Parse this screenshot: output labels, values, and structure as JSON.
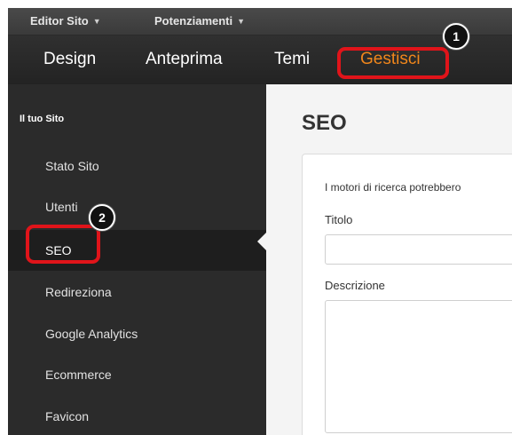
{
  "topbar": {
    "site_editor": "Editor Sito",
    "upgrades": "Potenziamenti",
    "caret": "▼"
  },
  "nav": {
    "design": "Design",
    "preview": "Anteprima",
    "themes": "Temi",
    "manage": "Gestisci"
  },
  "badges": {
    "step1": "1",
    "step2": "2"
  },
  "sidebar": {
    "title": "Il tuo Sito",
    "items": [
      {
        "label": "Stato Sito"
      },
      {
        "label": "Utenti"
      },
      {
        "label": "SEO"
      },
      {
        "label": "Redireziona"
      },
      {
        "label": "Google Analytics"
      },
      {
        "label": "Ecommerce"
      },
      {
        "label": "Favicon"
      }
    ],
    "selected": "SEO"
  },
  "main": {
    "title": "SEO",
    "description": "I motori di ricerca potrebbero",
    "title_label": "Titolo",
    "title_value": "",
    "description_label": "Descrizione",
    "description_value": ""
  },
  "colors": {
    "accent_active": "#f0861b",
    "highlight": "#e0141a",
    "sidebar_bg": "#2b2b2b"
  }
}
